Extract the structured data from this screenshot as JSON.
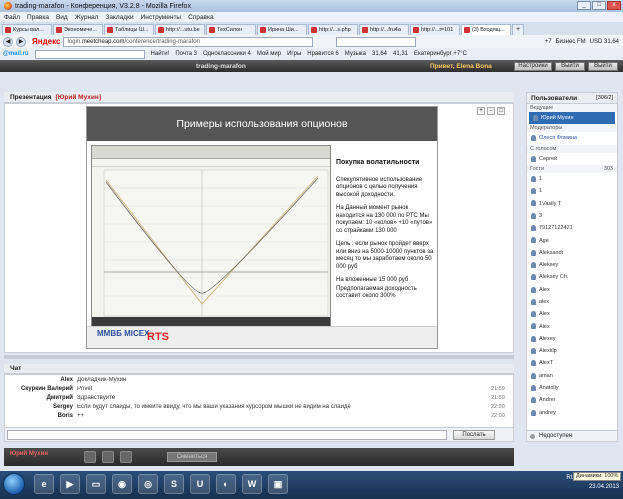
{
  "window": {
    "title": "trading-marafon - Конференция, V3.2.8 - Mozilla Firefox"
  },
  "menu": [
    "Файл",
    "Правка",
    "Вид",
    "Журнал",
    "Закладки",
    "Инструменты",
    "Справка"
  ],
  "tabs": [
    "Курсы вал...",
    "Экономиче...",
    "Таблицы Ш...",
    "http://...utu.be",
    "ТехСилон",
    "Ирина Ши...",
    "http://...s.php",
    "http://...fru4a",
    "http://...t=101",
    "(3) Входящ..."
  ],
  "tab_plus": "+",
  "nav": {
    "yandex": "Яндекс",
    "url_prefix": "login.",
    "url_domain": "meetcheap.com",
    "url_path": "/conference/trading-marafon",
    "weather": "+7",
    "business_fm": "Бизнес FM",
    "usd": "USD 31,64"
  },
  "mailbar": {
    "logo": "@mail.ru",
    "find": "Найти!",
    "mail": "Почта 3",
    "ok": "Одноклассники 4",
    "myworld": "Мой мир",
    "games": "Игры",
    "likes": "Нравится 6",
    "music": "Музыка",
    "rate1": "31,64",
    "rate2": "41,31",
    "city": "Екатеринбург +7°C"
  },
  "app": {
    "room": "trading-marafon",
    "greeting": "Привет, Elena Bona",
    "settings": "Настройки",
    "leave": "Выйти",
    "exit": "Выйти"
  },
  "presentation": {
    "label": "Презентация",
    "presenter": "[Юрий Мухин]",
    "slide_title": "Примеры использования опционов",
    "heading": "Покупка волатильности",
    "p1": "Спекулятивное использование опционов с целью получения высокой доходности.",
    "p2": "На Данный момент рынок находится на 130 000 по РТС Мы покупаем:  10 «колов» +10 «путов» со страйками 130 000",
    "p3": "Цель : если рынок пройдет вверх или вниз на 5000-10000 пунктов за месяц то мы заработаем около 50 000 руб",
    "p4": "На вложенные 15 000 руб",
    "p5": "Предполагаемая доходность составит около 300%",
    "micex": "ММВБ MICEX",
    "rts": "RTS"
  },
  "chat": {
    "label": "Чат",
    "messages": [
      {
        "nick": "Alex",
        "msg": "Докладчик-Мухин",
        "time": ""
      },
      {
        "nick": "Скуркин Валерий",
        "msg": "Privet",
        "time": "21:59"
      },
      {
        "nick": "Дмитрий",
        "msg": "Здравствуйте",
        "time": "21:59"
      },
      {
        "nick": "Sergey",
        "msg": "Если будут слайды, то имейте ввиду, что мы ваши указания курсором мышки не видим на слайде",
        "time": "22:00"
      },
      {
        "nick": "Boris",
        "msg": "++",
        "time": "22:00"
      }
    ],
    "send": "Послать"
  },
  "controls": {
    "me": "Юрий Мухин",
    "btn": "Смениться"
  },
  "users": {
    "title": "Пользователи",
    "count": "[306/2]",
    "group_lead": "Ведущие",
    "lead": "Юрий Мухин",
    "group_mod": "Модераторы",
    "mod": "Олеся Фомина",
    "group_voice": "С голосом",
    "voice": "Сергей",
    "group_guests": "Гости",
    "guests_count": "303",
    "guests": [
      "1",
      "1",
      "1Vasily T",
      "3",
      "79127122421",
      "Age",
      "Aleksandr",
      "Aleksey",
      "Aleksey Ch.",
      "Alex",
      "alex",
      "Alex",
      "Alex",
      "Alexey",
      "Alexklp",
      "AlexT",
      "aman",
      "Anatoliy",
      "Andrei",
      "andrey"
    ],
    "status": "Недоступен"
  },
  "taskbar": {
    "lang": "RU",
    "time": "22:22",
    "date": "23.04.2013",
    "tooltip": "Динамики: 100%"
  }
}
